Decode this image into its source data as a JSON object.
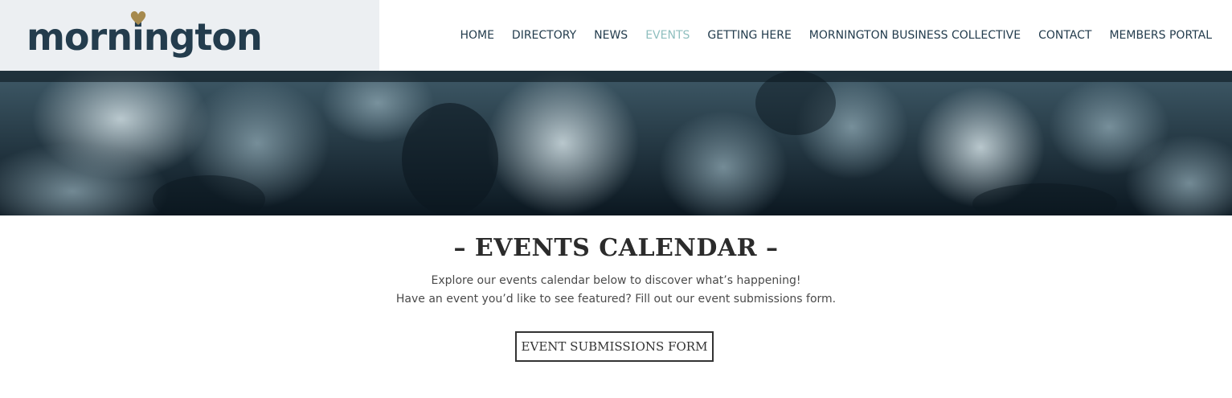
{
  "brand": {
    "logo_text": "mornington",
    "accent_color": "#a68a4e",
    "primary_color": "#233c4d"
  },
  "nav": {
    "items": [
      {
        "label": "HOME",
        "active": false
      },
      {
        "label": "DIRECTORY",
        "active": false
      },
      {
        "label": "NEWS",
        "active": false
      },
      {
        "label": "EVENTS",
        "active": true
      },
      {
        "label": "GETTING HERE",
        "active": false
      },
      {
        "label": "MORNINGTON BUSINESS COLLECTIVE",
        "active": false
      },
      {
        "label": "CONTACT",
        "active": false
      },
      {
        "label": "MEMBERS PORTAL",
        "active": false
      }
    ],
    "active_color": "#8fbfbf"
  },
  "hero": {
    "image": "concert-crowd-photo"
  },
  "main": {
    "title": "– EVENTS CALENDAR –",
    "intro_line1": "Explore our events calendar below to discover what’s happening!",
    "intro_line2": "Have an event you’d like to see featured? Fill out our event submissions form.",
    "button_label": "EVENT SUBMISSIONS FORM"
  }
}
